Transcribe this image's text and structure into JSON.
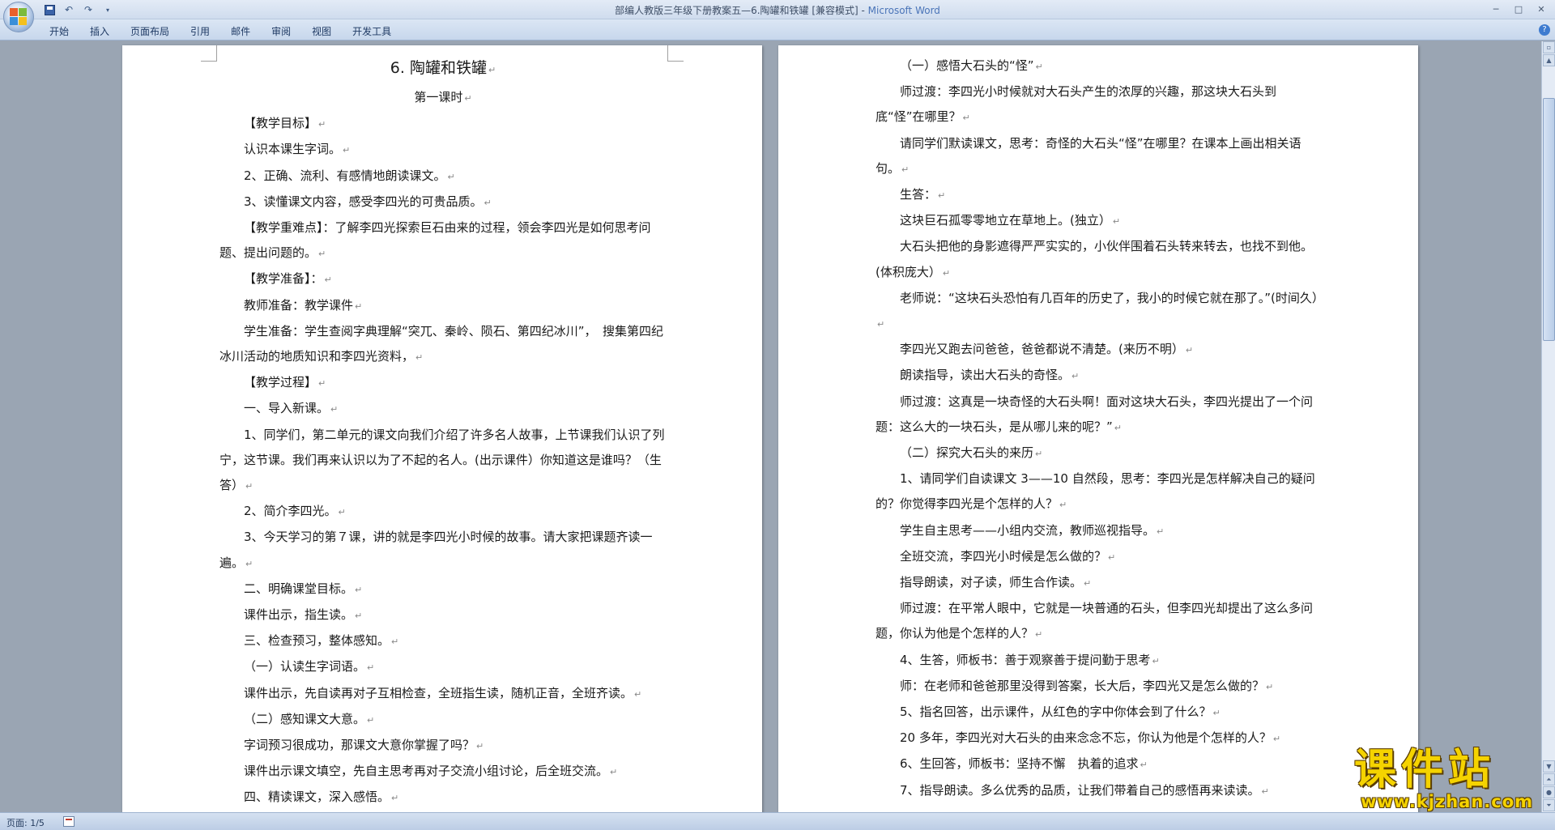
{
  "window": {
    "title": "部编人教版三年级下册教案五—6.陶罐和铁罐 [兼容模式] - ",
    "app_name": "Microsoft Word"
  },
  "ribbon": {
    "tabs": [
      "开始",
      "插入",
      "页面布局",
      "引用",
      "邮件",
      "审阅",
      "视图",
      "开发工具"
    ]
  },
  "left_page": {
    "paragraphs": [
      "6. 陶罐和铁罐",
      "第一课时",
      "【教学目标】",
      "认识本课生字词。",
      "2、正确、流利、有感情地朗读课文。",
      "3、读懂课文内容，感受李四光的可贵品质。",
      "【教学重难点】：了解李四光探索巨石由来的过程，领会李四光是如何思考问题、提出问题的。",
      "【教学准备】：",
      "教师准备：教学课件",
      "学生准备：学生查阅字典理解“突兀、秦岭、陨石、第四纪冰川”，　搜集第四纪冰川活动的地质知识和李四光资料，",
      "【教学过程】",
      "一、导入新课。",
      "1、同学们，第二单元的课文向我们介绍了许多名人故事，上节课我们认识了列宁，这节课。我们再来认识以为了不起的名人。(出示课件）你知道这是谁吗？（生答）",
      "2、简介李四光。",
      "3、今天学习的第７课，讲的就是李四光小时候的故事。请大家把课题齐读一遍。",
      "二、明确课堂目标。",
      "课件出示，指生读。",
      "三、检查预习，整体感知。",
      "（一）认读生字词语。",
      "课件出示，先自读再对子互相检查，全班指生读，随机正音，全班齐读。",
      "（二）感知课文大意。",
      "字词预习很成功，那课文大意你掌握了吗？",
      "课件出示课文填空，先自主思考再对子交流小组讨论，后全班交流。",
      "四、精读课文，深入感悟。"
    ]
  },
  "right_page": {
    "paragraphs": [
      "（一）感悟大石头的“怪”",
      "师过渡：李四光小时候就对大石头产生的浓厚的兴趣，那这块大石头到底“怪”在哪里？",
      "请同学们默读课文，思考：奇怪的大石头“怪”在哪里？在课本上画出相关语句。",
      "生答：",
      "这块巨石孤零零地立在草地上。(独立）",
      "大石头把他的身影遮得严严实实的，小伙伴围着石头转来转去，也找不到他。(体积庞大）",
      "老师说：“这块石头恐怕有几百年的历史了，我小的时候它就在那了。”(时间久）",
      "李四光又跑去问爸爸，爸爸都说不清楚。(来历不明）",
      "朗读指导，读出大石头的奇怪。",
      "师过渡：这真是一块奇怪的大石头啊！面对这块大石头，李四光提出了一个问题：这么大的一块石头，是从哪儿来的呢？”",
      "（二）探究大石头的来历",
      "1、请同学们自读课文 3——10 自然段，思考：李四光是怎样解决自己的疑问的？你觉得李四光是个怎样的人？",
      "学生自主思考——小组内交流，教师巡视指导。",
      "全班交流，李四光小时候是怎么做的？",
      "指导朗读，对子读，师生合作读。",
      "师过渡：在平常人眼中，它就是一块普通的石头，但李四光却提出了这么多问题，你认为他是个怎样的人？",
      "4、生答，师板书：善于观察善于提问勤于思考",
      "师：在老师和爸爸那里没得到答案，长大后，李四光又是怎么做的？",
      "5、指名回答，出示课件，从红色的字中你体会到了什么？",
      "20 多年，李四光对大石头的由来念念不忘，你认为他是个怎样的人？",
      "6、生回答，师板书：坚持不懈　执着的追求",
      "7、指导朗读。多么优秀的品质，让我们带着自己的感悟再来读读。"
    ]
  },
  "statusbar": {
    "page_info": "页面: 1/5"
  },
  "watermark": {
    "main": "课件站",
    "url": "www.kjzhan.com"
  }
}
